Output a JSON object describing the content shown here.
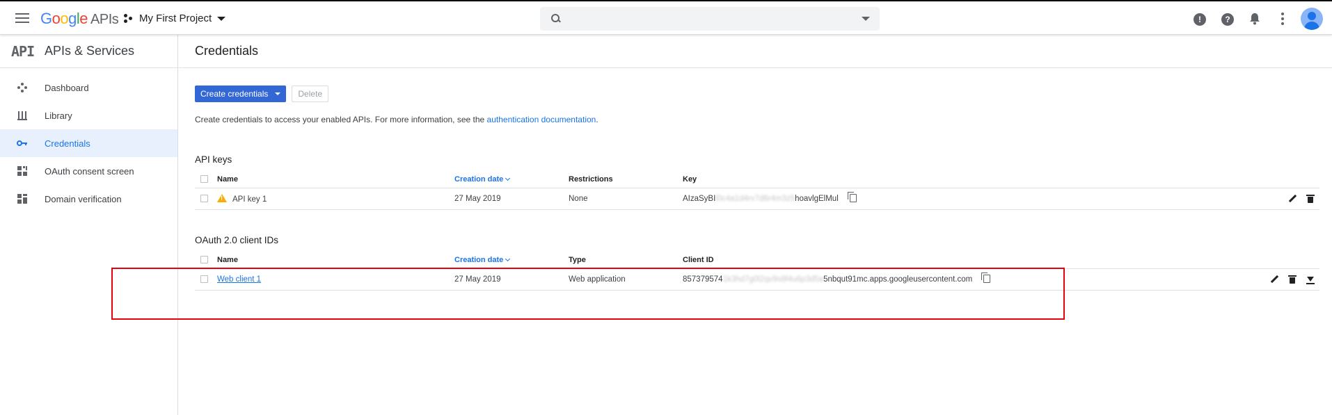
{
  "header": {
    "logo_google": "Google",
    "logo_apis": "APIs",
    "project_name": "My First Project",
    "search_placeholder": "",
    "feedback_icon_glyph": "!",
    "help_icon_glyph": "?"
  },
  "sidebar": {
    "logo": "API",
    "title": "APIs & Services",
    "items": [
      {
        "label": "Dashboard",
        "icon": "dashboard-icon"
      },
      {
        "label": "Library",
        "icon": "library-icon"
      },
      {
        "label": "Credentials",
        "icon": "key-icon",
        "active": true
      },
      {
        "label": "OAuth consent screen",
        "icon": "consent-icon"
      },
      {
        "label": "Domain verification",
        "icon": "domain-icon"
      }
    ]
  },
  "main": {
    "title": "Credentials",
    "create_label": "Create credentials",
    "delete_label": "Delete",
    "intro_text": "Create credentials to access your enabled APIs. For more information, see the ",
    "intro_link": "authentication documentation",
    "intro_end": ".",
    "api_keys": {
      "title": "API keys",
      "columns": {
        "name": "Name",
        "date": "Creation date",
        "restrictions": "Restrictions",
        "key": "Key"
      },
      "rows": [
        {
          "name": "API key 1",
          "date": "27 May 2019",
          "restrictions": "None",
          "key_start": "AIzaSyBI",
          "key_hidden": "l0c4a1d4rv7d6r4m3z5",
          "key_end": "hoavlgElMul"
        }
      ]
    },
    "oauth": {
      "title": "OAuth 2.0 client IDs",
      "columns": {
        "name": "Name",
        "date": "Creation date",
        "type": "Type",
        "client_id": "Client ID"
      },
      "rows": [
        {
          "name": "Web client 1",
          "date": "27 May 2019",
          "type": "Web application",
          "id_start": "857379574",
          "id_hidden": "1k3hd7g0l2qv9s8f4u6p3d5a",
          "id_end": "5nbqut91mc.apps.googleusercontent.com"
        }
      ]
    }
  },
  "colors": {
    "accent": "#3367d6",
    "link": "#1a73e8",
    "highlight": "#e8000d",
    "warning": "#f9ab00"
  }
}
